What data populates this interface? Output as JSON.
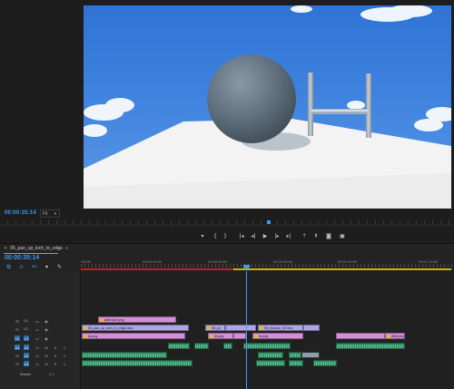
{
  "program_monitor": {
    "timecode": "00:00:35:14",
    "fit_label": "Fit",
    "transport_icons": [
      "add-marker-icon",
      "mark-in-icon",
      "mark-out-icon",
      "go-to-in-icon",
      "step-back-icon",
      "play-icon",
      "step-forward-icon",
      "go-to-out-icon",
      "lift-icon",
      "extract-icon",
      "export-frame-icon",
      "button-editor-icon"
    ]
  },
  "timeline": {
    "sequence_name": "05_pan_up_loch_to_edge",
    "timecode": "00:00:35:14",
    "ruler_labels": [
      ":00:00",
      "00:00:15:00",
      "00:00:30:00",
      "00:00:45:00",
      "00:01:00:00",
      "00:01:15:00"
    ],
    "video_tracks": [
      {
        "name": "V3",
        "target": "V3"
      },
      {
        "name": "V2",
        "target": "V2"
      },
      {
        "name": "V1",
        "target": "V1"
      }
    ],
    "audio_tracks": [
      {
        "name": "A1",
        "target": "A1",
        "m": "M",
        "s": "S"
      },
      {
        "name": "A2",
        "target": "A2",
        "m": "M",
        "s": "S"
      },
      {
        "name": "A3",
        "target": "A3",
        "m": "M",
        "s": "S"
      }
    ],
    "master": {
      "label": "Master",
      "value": "0.0"
    },
    "clips": {
      "v3": "Aftercarb.png",
      "v2_a": "05_pan_up_loch_to_edge.mov",
      "v2_b": "05_pn",
      "v2_c": "06_bounce_02.mov",
      "v1_a": "rb.png",
      "v1_b": "rb.png",
      "v1_c": "rb.png",
      "v1_d": "Aftef.png"
    }
  },
  "colors": {
    "accent": "#3b9cf5",
    "clip_pink": "#d48fd6",
    "clip_violet": "#b0a4e6",
    "clip_audio": "#2e8a62"
  }
}
